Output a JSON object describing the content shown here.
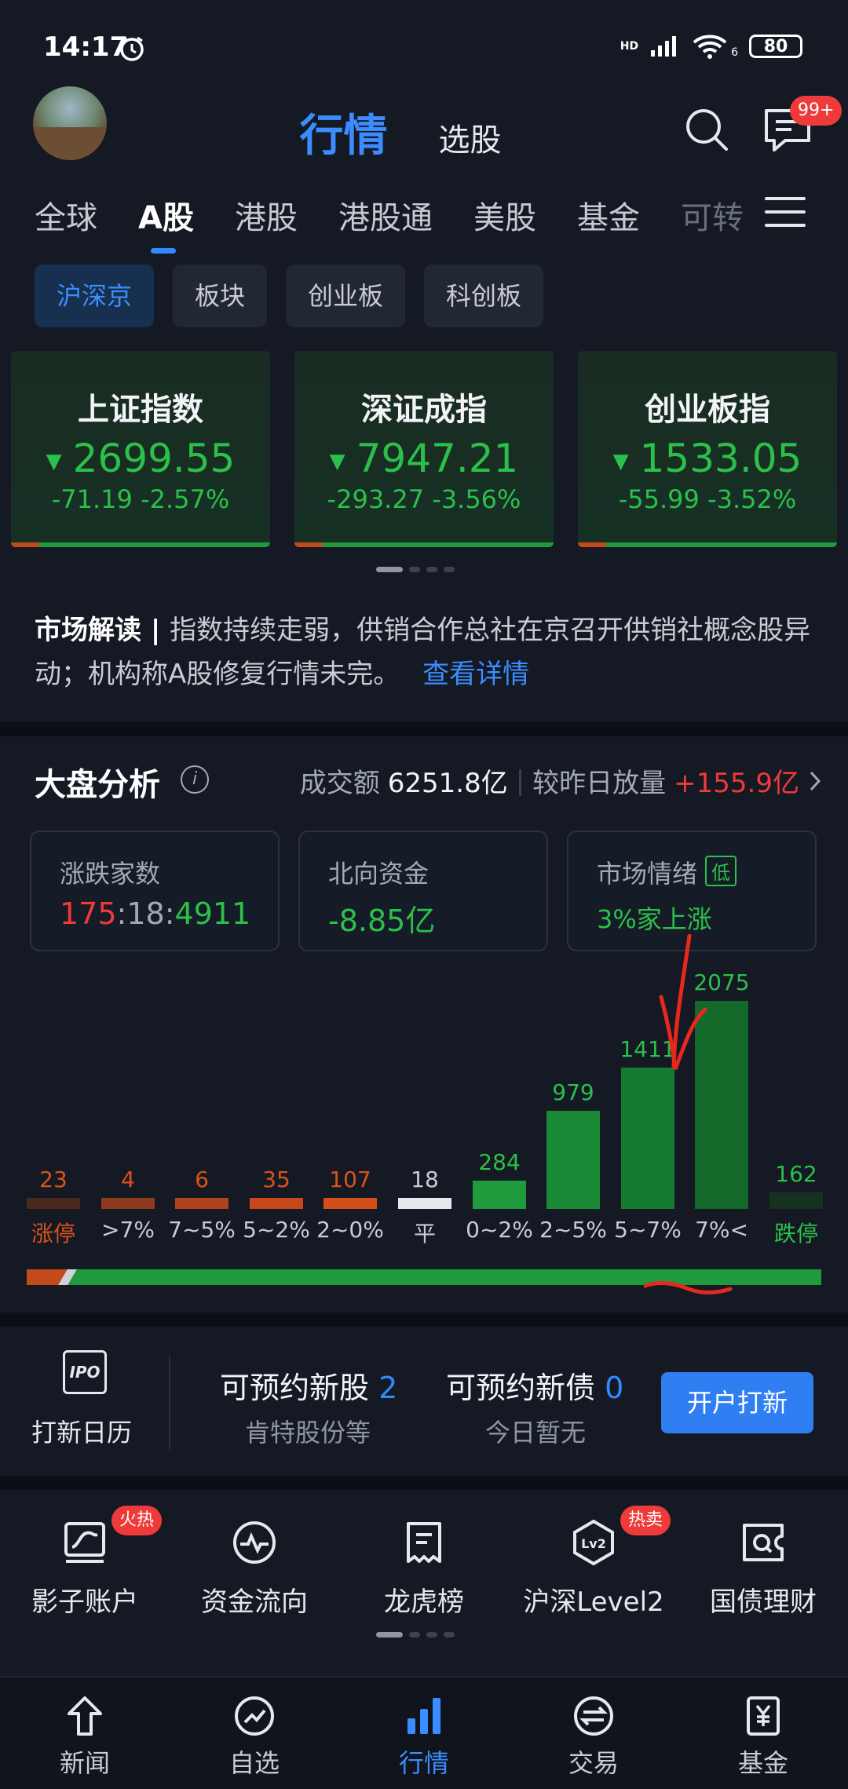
{
  "status": {
    "time": "14:17",
    "network": "HD",
    "wifi_sub": "6",
    "battery": "80"
  },
  "header": {
    "title": "行情",
    "secondary": "选股",
    "message_badge": "99+"
  },
  "tabs": [
    "全球",
    "A股",
    "港股",
    "港股通",
    "美股",
    "基金",
    "可转"
  ],
  "active_tab": "A股",
  "subtabs": [
    "沪深京",
    "板块",
    "创业板",
    "科创板"
  ],
  "indices": [
    {
      "name": "上证指数",
      "value": "2699.55",
      "change": "-71.19 -2.57%"
    },
    {
      "name": "深证成指",
      "value": "7947.21",
      "change": "-293.27 -3.56%"
    },
    {
      "name": "创业板指",
      "value": "1533.05",
      "change": "-55.99 -3.52%"
    }
  ],
  "news": {
    "label": "市场解读",
    "text": "指数持续走弱，供销合作总社在京召开供销社概念股异动；机构称A股修复行情未完。",
    "link": "查看详情"
  },
  "analysis": {
    "title": "大盘分析",
    "turnover_label": "成交额",
    "turnover_value": "6251.8亿",
    "vol_label": "较昨日放量",
    "vol_value": "+155.9亿",
    "stats": {
      "updown_label": "涨跌家数",
      "up": "175",
      "flat": "18",
      "down": "4911",
      "northbound_label": "北向资金",
      "northbound_value": "-8.85亿",
      "sentiment_label": "市场情绪",
      "sentiment_tag": "低",
      "sentiment_value": "3%家上涨"
    }
  },
  "chart_data": {
    "type": "bar",
    "categories": [
      "涨停",
      ">7%",
      "7~5%",
      "5~2%",
      "2~0%",
      "平",
      "0~2%",
      "2~5%",
      "5~7%",
      "7%<",
      "跌停"
    ],
    "values": [
      23,
      4,
      6,
      35,
      107,
      18,
      284,
      979,
      1411,
      2075,
      162
    ],
    "colors": [
      "#4a2a1f",
      "#8e3a1d",
      "#b0421c",
      "#c6481b",
      "#d24e1a",
      "#e6e8ee",
      "#1f9a3c",
      "#1b8a36",
      "#167a30",
      "#13692a",
      "#16311f"
    ],
    "label_colors": [
      "#d9521c",
      "#d9521c",
      "#d9521c",
      "#d9521c",
      "#d9521c",
      "#c9ccd4",
      "#2bc04a",
      "#2bc04a",
      "#2bc04a",
      "#2bc04a",
      "#2bc04a"
    ],
    "xlabel_colors": [
      "#d9521c",
      "#c9ccd4",
      "#c9ccd4",
      "#c9ccd4",
      "#c9ccd4",
      "#c9ccd4",
      "#c9ccd4",
      "#c9ccd4",
      "#c9ccd4",
      "#c9ccd4",
      "#2bc04a"
    ]
  },
  "ipo": {
    "calendar_label": "打新日历",
    "calendar_icon_text": "IPO",
    "stocks_label": "可预约新股",
    "stocks_count": "2",
    "stocks_sub": "肯特股份等",
    "bonds_label": "可预约新债",
    "bonds_count": "0",
    "bonds_sub": "今日暂无",
    "button": "开户打新"
  },
  "tools": [
    {
      "label": "影子账户",
      "badge": "火热"
    },
    {
      "label": "资金流向",
      "badge": ""
    },
    {
      "label": "龙虎榜",
      "badge": ""
    },
    {
      "label": "沪深Level2",
      "badge": "热卖"
    },
    {
      "label": "国债理财",
      "badge": ""
    }
  ],
  "nav": [
    "新闻",
    "自选",
    "行情",
    "交易",
    "基金"
  ],
  "nav_active": "行情"
}
